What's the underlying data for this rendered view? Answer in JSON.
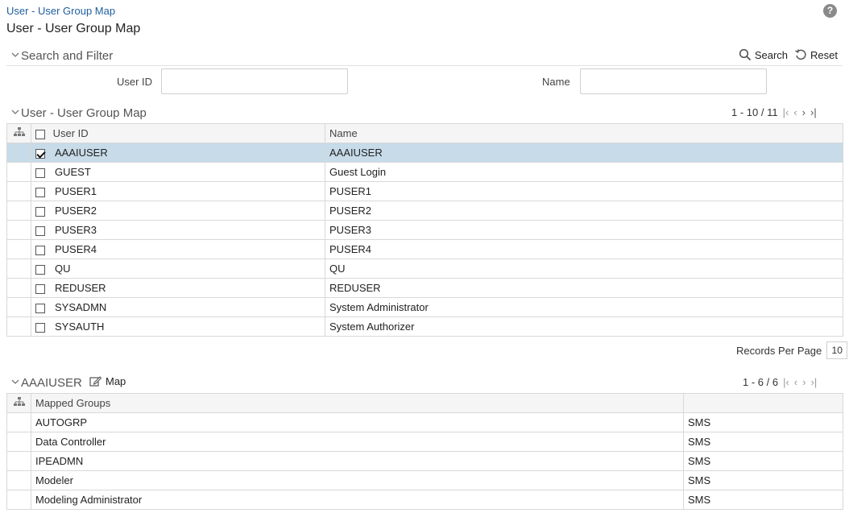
{
  "breadcrumb": "User - User Group Map",
  "page_title": "User - User Group Map",
  "search_filter": {
    "title": "Search and Filter",
    "search_label": "Search",
    "reset_label": "Reset",
    "user_id_label": "User ID",
    "user_id_value": "",
    "name_label": "Name",
    "name_value": ""
  },
  "user_grid": {
    "title": "User - User Group Map",
    "pager": "1 - 10 / 11",
    "columns": [
      "User ID",
      "Name"
    ],
    "rows": [
      {
        "user_id": "AAAIUSER",
        "name": "AAAIUSER",
        "checked": true
      },
      {
        "user_id": "GUEST",
        "name": "Guest Login",
        "checked": false
      },
      {
        "user_id": "PUSER1",
        "name": "PUSER1",
        "checked": false
      },
      {
        "user_id": "PUSER2",
        "name": "PUSER2",
        "checked": false
      },
      {
        "user_id": "PUSER3",
        "name": "PUSER3",
        "checked": false
      },
      {
        "user_id": "PUSER4",
        "name": "PUSER4",
        "checked": false
      },
      {
        "user_id": "QU",
        "name": "QU",
        "checked": false
      },
      {
        "user_id": "REDUSER",
        "name": "REDUSER",
        "checked": false
      },
      {
        "user_id": "SYSADMN",
        "name": "System Administrator",
        "checked": false
      },
      {
        "user_id": "SYSAUTH",
        "name": "System Authorizer",
        "checked": false
      }
    ],
    "records_per_page_label": "Records Per Page",
    "records_per_page": "10"
  },
  "mapped_grid": {
    "title": "AAAIUSER",
    "map_label": "Map",
    "pager": "1 - 6 / 6",
    "columns": [
      "Mapped Groups",
      ""
    ],
    "rows": [
      {
        "group": "AUTOGRP",
        "segment": "SMS"
      },
      {
        "group": "Data Controller",
        "segment": "SMS"
      },
      {
        "group": "IPEADMN",
        "segment": "SMS"
      },
      {
        "group": "Modeler",
        "segment": "SMS"
      },
      {
        "group": "Modeling Administrator",
        "segment": "SMS"
      }
    ]
  },
  "colors": {
    "link": "#1f5e9e",
    "selected_row": "#c7dbe9",
    "border": "#d8d8d8"
  }
}
